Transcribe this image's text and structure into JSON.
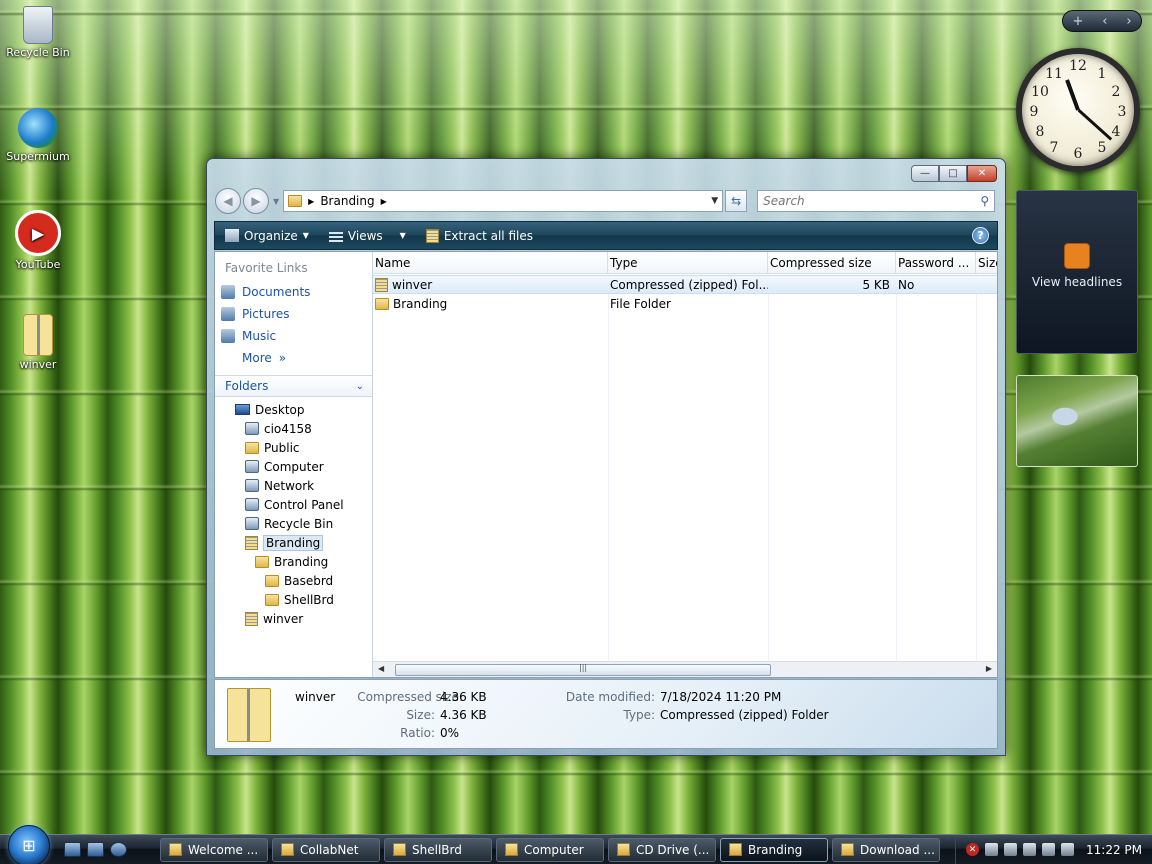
{
  "desktop_icons": [
    {
      "label": "Recycle Bin",
      "icon": "recycle-bin-icon"
    },
    {
      "label": "Supermium",
      "icon": "supermium-icon"
    },
    {
      "label": "YouTube",
      "icon": "youtube-icon"
    },
    {
      "label": "winver",
      "icon": "zip-folder-icon"
    }
  ],
  "sidebar": {
    "controls": {
      "add": "+",
      "prev": "‹",
      "next": "›"
    },
    "feed_label": "View headlines"
  },
  "window": {
    "caption": {
      "minimize": "—",
      "maximize": "□",
      "close": "✕"
    },
    "address": {
      "crumb": "Branding"
    },
    "search": {
      "placeholder": "Search"
    },
    "toolbar": {
      "organize": "Organize",
      "views": "Views",
      "extract": "Extract all files"
    },
    "nav": {
      "favorite_links_title": "Favorite Links",
      "favorite_links": [
        "Documents",
        "Pictures",
        "Music"
      ],
      "more": "More",
      "folders_title": "Folders",
      "tree": [
        {
          "label": "Desktop",
          "icon": "desktop-icon",
          "indent": 0
        },
        {
          "label": "cio4158",
          "icon": "user-icon",
          "indent": 1
        },
        {
          "label": "Public",
          "icon": "folder-icon",
          "indent": 1
        },
        {
          "label": "Computer",
          "icon": "computer-icon",
          "indent": 1
        },
        {
          "label": "Network",
          "icon": "network-icon",
          "indent": 1
        },
        {
          "label": "Control Panel",
          "icon": "control-panel-icon",
          "indent": 1
        },
        {
          "label": "Recycle Bin",
          "icon": "recycle-bin-icon",
          "indent": 1
        },
        {
          "label": "Branding",
          "icon": "zip-folder-icon",
          "indent": 1,
          "selected": true
        },
        {
          "label": "Branding",
          "icon": "folder-icon",
          "indent": 2
        },
        {
          "label": "Basebrd",
          "icon": "folder-icon",
          "indent": 3
        },
        {
          "label": "ShellBrd",
          "icon": "folder-icon",
          "indent": 3
        },
        {
          "label": "winver",
          "icon": "zip-folder-icon",
          "indent": 1
        }
      ]
    },
    "columns": [
      "Name",
      "Type",
      "Compressed size",
      "Password ...",
      "Size"
    ],
    "rows": [
      {
        "name": "winver",
        "type": "Compressed (zipped) Fol...",
        "compressed_size": "5 KB",
        "password": "No",
        "selected": true
      },
      {
        "name": "Branding",
        "type": "File Folder",
        "compressed_size": "",
        "password": ""
      }
    ],
    "details": {
      "name": "winver",
      "compressed_size_label": "Compressed size:",
      "compressed_size": "4.36 KB",
      "size_label": "Size:",
      "size": "4.36 KB",
      "ratio_label": "Ratio:",
      "ratio": "0%",
      "date_label": "Date modified:",
      "date": "7/18/2024 11:20 PM",
      "type_label": "Type:",
      "type": "Compressed (zipped) Folder"
    }
  },
  "taskbar": {
    "tasks": [
      {
        "label": "Welcome ..."
      },
      {
        "label": "CollabNet"
      },
      {
        "label": "ShellBrd"
      },
      {
        "label": "Computer"
      },
      {
        "label": "CD Drive (..."
      },
      {
        "label": "Branding",
        "active": true
      },
      {
        "label": "Download ..."
      }
    ],
    "clock": "11:22 PM"
  }
}
